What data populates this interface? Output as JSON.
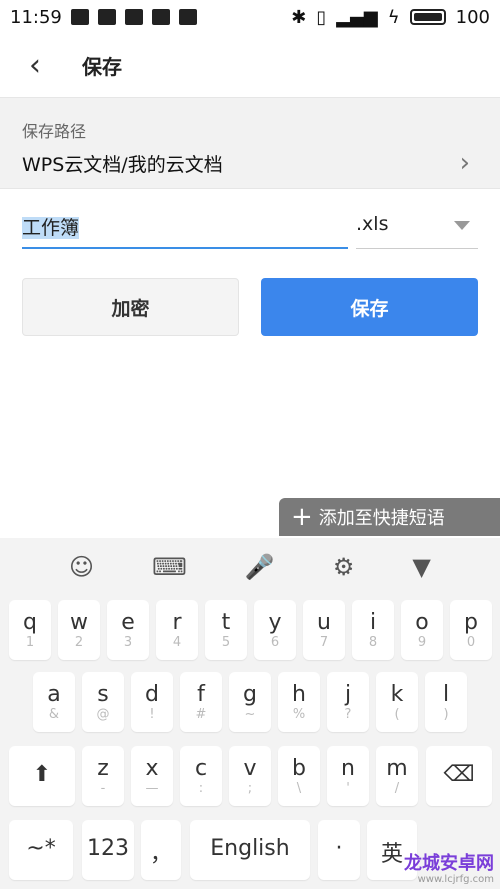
{
  "status": {
    "time": "11:59",
    "battery": "100",
    "battery_level": 1.0
  },
  "header": {
    "back_icon": "‹",
    "title": "保存"
  },
  "path": {
    "label": "保存路径",
    "value": "WPS云文档/我的云文档",
    "chevron": "›"
  },
  "file": {
    "name": "工作簿",
    "ext": ".xls"
  },
  "buttons": {
    "encrypt": "加密",
    "save": "保存"
  },
  "phrase": {
    "icon": "+",
    "label": "添加至快捷短语"
  },
  "keyboard": {
    "toolbar": [
      "☺",
      "⌨",
      "🎤",
      "⚙",
      "▼"
    ],
    "row1": [
      [
        "q",
        "1"
      ],
      [
        "w",
        "2"
      ],
      [
        "e",
        "3"
      ],
      [
        "r",
        "4"
      ],
      [
        "t",
        "5"
      ],
      [
        "y",
        "6"
      ],
      [
        "u",
        "7"
      ],
      [
        "i",
        "8"
      ],
      [
        "o",
        "9"
      ],
      [
        "p",
        "0"
      ]
    ],
    "row2": [
      [
        "a",
        "&"
      ],
      [
        "s",
        "@"
      ],
      [
        "d",
        "!"
      ],
      [
        "f",
        "#"
      ],
      [
        "g",
        "~"
      ],
      [
        "h",
        "%"
      ],
      [
        "j",
        "?"
      ],
      [
        "k",
        "("
      ],
      [
        "l",
        ")"
      ]
    ],
    "row3": [
      [
        "z",
        "-"
      ],
      [
        "x",
        "—"
      ],
      [
        "c",
        ":"
      ],
      [
        "v",
        ";"
      ],
      [
        "b",
        "\\"
      ],
      [
        "n",
        "'"
      ],
      [
        "m",
        "/"
      ]
    ],
    "shift": "⬆",
    "delete": "⌫",
    "row4": {
      "sym": "~*",
      "num": "123",
      "comma": "，",
      "space": "English",
      "period": "·",
      "lang": "英"
    }
  },
  "watermark": {
    "text": "龙城安卓网",
    "url": "www.lcjrfg.com"
  }
}
